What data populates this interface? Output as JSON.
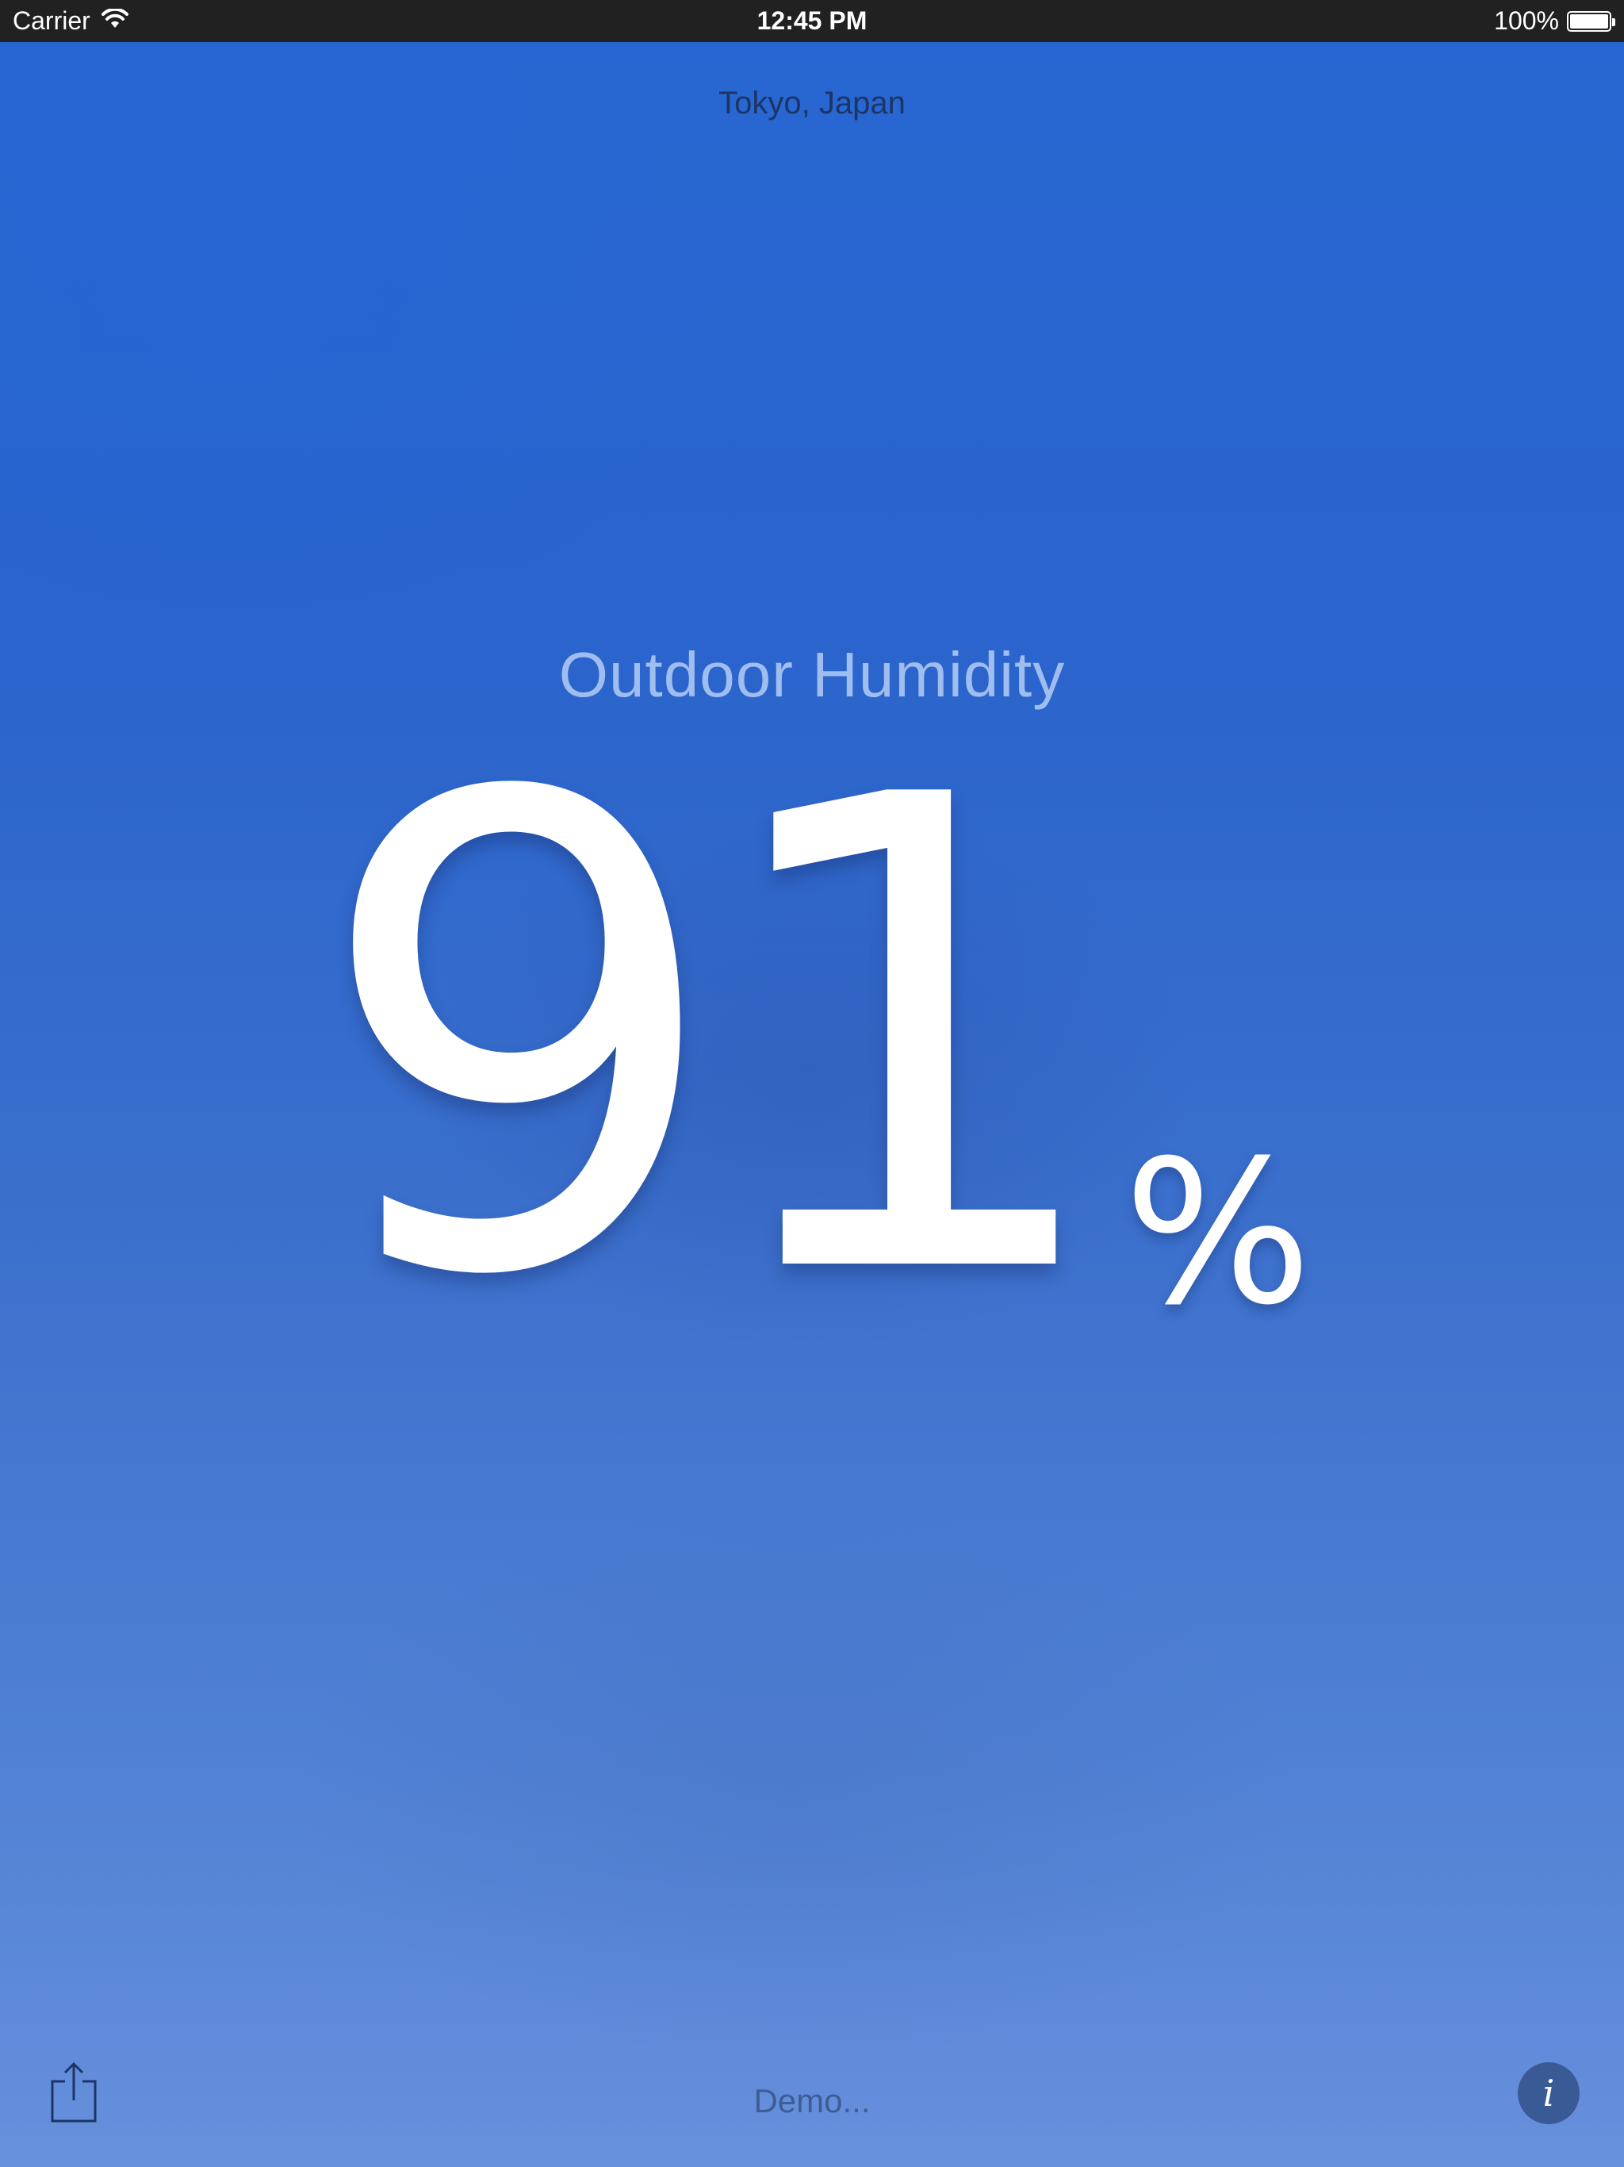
{
  "status_bar": {
    "carrier": "Carrier",
    "time": "12:45 PM",
    "battery": "100%",
    "battery_level": 1.0,
    "icons": [
      "wifi-icon",
      "battery-icon"
    ]
  },
  "location": "Tokyo, Japan",
  "metric": {
    "title": "Outdoor Humidity",
    "value": "91",
    "unit": "%"
  },
  "footer": {
    "demo_label": "Demo...",
    "info_label": "i",
    "icons": [
      "share-icon",
      "info-icon"
    ]
  },
  "colors": {
    "status_bar_bg": "#212121",
    "background_top": "#2766d2",
    "background_bottom": "#6790dc",
    "info_button_bg": "#3a5a95"
  }
}
